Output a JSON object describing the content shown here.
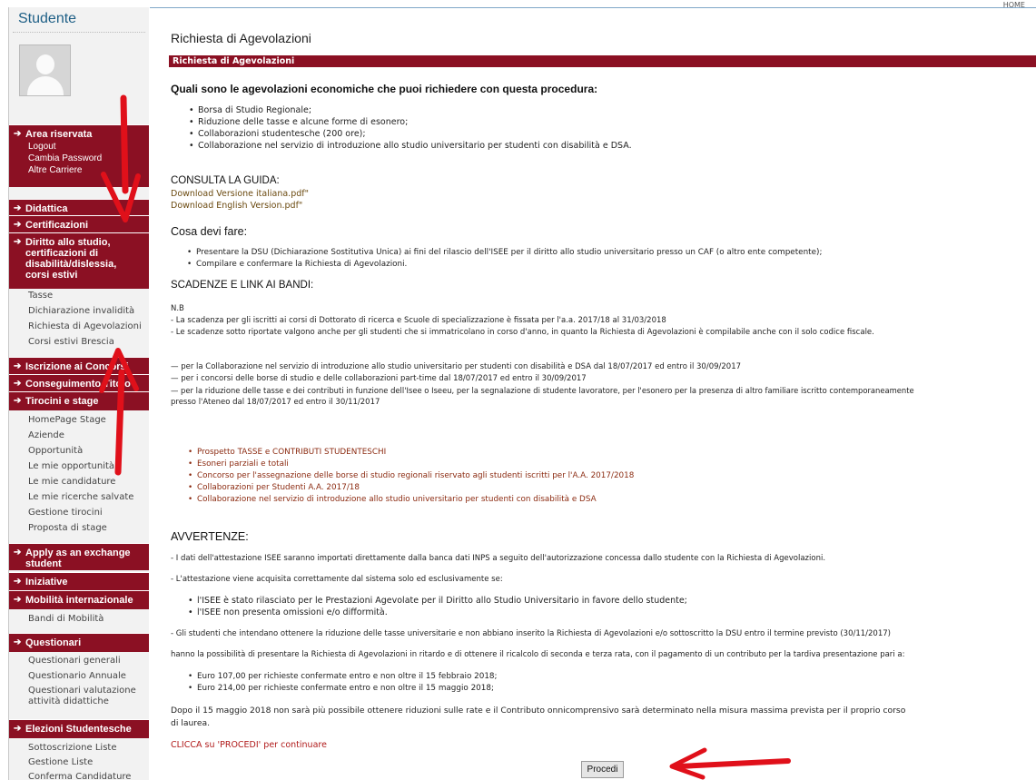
{
  "header": {
    "home_label": "HOME"
  },
  "sidebar": {
    "title": "Studente",
    "area_riservata": {
      "label": "Area riservata",
      "items": [
        "Logout",
        "Cambia Password",
        "Altre Carriere"
      ]
    },
    "sections": [
      {
        "label": "Didattica"
      },
      {
        "label": "Certificazioni"
      },
      {
        "label": "Diritto allo studio, certificazioni di disabilità/dislessia, corsi estivi",
        "items": [
          "Tasse",
          "Dichiarazione invalidità",
          "Richiesta di Agevolazioni",
          "Corsi estivi Brescia"
        ]
      },
      {
        "label": "Iscrizione ai Concorsi"
      },
      {
        "label": "Conseguimento Titolo"
      },
      {
        "label": "Tirocini e stage",
        "items": [
          "HomePage Stage",
          "Aziende",
          "Opportunità",
          "Le mie opportunità",
          "Le mie candidature",
          "Le mie ricerche salvate",
          "Gestione tirocini",
          "Proposta di stage"
        ]
      },
      {
        "label": "Apply as an exchange student"
      },
      {
        "label": "Iniziative"
      },
      {
        "label": "Mobilità internazionale",
        "items": [
          "Bandi di Mobilità"
        ]
      },
      {
        "label": "Questionari",
        "items": [
          "Questionari generali",
          "Questionario Annuale",
          "Questionari valutazione attività didattiche"
        ]
      },
      {
        "label": "Elezioni Studentesche",
        "items": [
          "Sottoscrizione Liste",
          "Gestione Liste",
          "Conferma Candidature"
        ]
      }
    ]
  },
  "main": {
    "title": "Richiesta di Agevolazioni",
    "bar_label": "Richiesta di Agevolazioni",
    "q_heading": "Quali sono le agevolazioni economiche che puoi richiedere con questa procedura:",
    "agevolazioni": [
      "Borsa di Studio Regionale;",
      "Riduzione delle tasse e alcune forme di esonero;",
      "Collaborazioni studentesche (200 ore);",
      "Collaborazione nel servizio di introduzione allo studio universitario per studenti con disabilità e DSA."
    ],
    "guida_heading": "CONSULTA LA GUIDA:",
    "guida_links": [
      "Download Versione italiana.pdf\"",
      "Download English Version.pdf\""
    ],
    "fare_heading": "Cosa devi fare:",
    "fare_items": [
      "Presentare la DSU (Dichiarazione Sostitutiva Unica) ai fini del rilascio dell'ISEE per il diritto allo studio universitario presso un CAF (o altro ente competente);",
      "Compilare e confermare la Richiesta di Agevolazioni."
    ],
    "scadenze_heading": "SCADENZE E LINK AI BANDI:",
    "nb_label": "N.B",
    "nb_lines": [
      "- La scadenza per gli iscritti ai corsi di Dottorato di ricerca e Scuole di specializzazione è fissata per l'a.a. 2017/18 al 31/03/2018",
      "- Le scadenze sotto riportate valgono anche per gli studenti che si immatricolano in corso d'anno, in quanto la Richiesta di Agevolazioni è compilabile anche con il solo codice fiscale."
    ],
    "deadlines": [
      "— per la Collaborazione nel servizio di introduzione allo studio universitario per studenti con disabilità e DSA dal 18/07/2017 ed entro il 30/09/2017",
      "— per i concorsi delle borse di studio e delle collaborazioni part-time dal 18/07/2017 ed entro il 30/09/2017",
      "— per la riduzione delle tasse e dei contributi in funzione dell'Isee o Iseeu, per la segnalazione di studente lavoratore, per l'esonero per la presenza di altro familiare iscritto contemporaneamente",
      "presso l'Ateneo dal 18/07/2017 ed entro il 30/11/2017"
    ],
    "bandi_links": [
      "Prospetto TASSE e CONTRIBUTI STUDENTESCHI",
      "Esoneri parziali e totali",
      "Concorso per l'assegnazione delle borse di studio regionali riservato agli studenti iscritti per l'A.A. 2017/2018",
      "Collaborazioni per Studenti A.A. 2017/18",
      "Collaborazione nel servizio di introduzione allo studio universitario per studenti con disabilità e DSA"
    ],
    "avvertenze_heading": "AVVERTENZE:",
    "avv_1": "- I dati dell'attestazione ISEE saranno importati direttamente dalla banca dati INPS a seguito dell'autorizzazione concessa dallo studente con la Richiesta di Agevolazioni.",
    "avv_2": "- L'attestazione viene acquisita correttamente dal sistema solo ed esclusivamente se:",
    "avv_conditions": [
      "l'ISEE è stato rilasciato per le Prestazioni Agevolate per il Diritto allo Studio Universitario in favore dello studente;",
      "l'ISEE non presenta omissioni e/o difformità."
    ],
    "avv_3": "- Gli studenti che intendano ottenere la riduzione delle tasse universitarie e non abbiano inserito la Richiesta di Agevolazioni e/o sottoscritto la DSU entro il termine previsto (30/11/2017)",
    "avv_4": "hanno la possibilità di presentare la Richiesta di Agevolazioni in ritardo e di ottenere il ricalcolo di seconda e terza rata, con il pagamento di un contributo per la tardiva presentazione pari a:",
    "fees": [
      "Euro 107,00 per richieste confermate entro e non oltre il 15 febbraio 2018;",
      "Euro 214,00 per richieste confermate entro e non oltre il 15 maggio 2018;"
    ],
    "final_1": "Dopo il 15 maggio 2018 non sarà più possibile ottenere riduzioni sulle rate e il Contributo onnicomprensivo sarà determinato nella misura massima prevista per il proprio corso",
    "final_2": "di laurea.",
    "procedi_note": "CLICCA su 'PROCEDI' per continuare",
    "procedi_button": "Procedi"
  },
  "annotations": {
    "arrow_color": "#e0101a"
  }
}
